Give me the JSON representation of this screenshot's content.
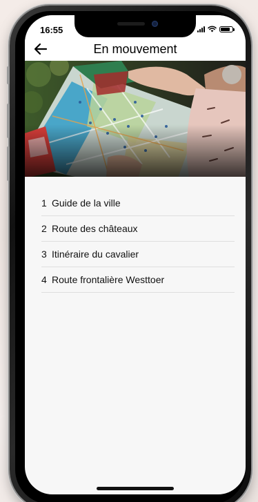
{
  "status": {
    "time": "16:55"
  },
  "nav": {
    "title": "En mouvement"
  },
  "hero": {
    "icon": "city-map-photo"
  },
  "list": {
    "items": [
      {
        "number": "1",
        "label": "Guide de la ville"
      },
      {
        "number": "2",
        "label": "Route des châteaux"
      },
      {
        "number": "3",
        "label": "Itinéraire du cavalier"
      },
      {
        "number": "4",
        "label": "Route frontalière Westtoer"
      }
    ]
  },
  "colors": {
    "screen_bg": "#f7f7f7",
    "nav_bg": "#ffffff",
    "divider": "#dedede",
    "text": "#111111"
  }
}
